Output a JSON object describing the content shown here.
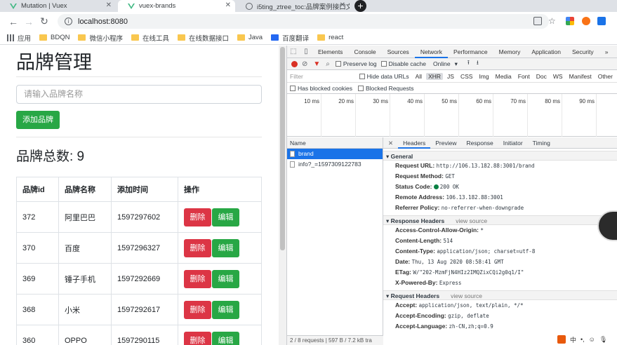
{
  "browser": {
    "tabs": [
      {
        "title": "Mutation | Vuex"
      },
      {
        "title": "vuex-brands"
      },
      {
        "title": "i5ting_ztree_toc:品牌案例接口文"
      }
    ],
    "url": "localhost:8080",
    "bookmarks": [
      "应用",
      "BDQN",
      "微信小程序",
      "在线工具",
      "在线数据接口",
      "Java",
      "百度翻译",
      "react"
    ]
  },
  "app": {
    "title": "品牌管理",
    "search_placeholder": "请输入品牌名称",
    "add_button": "添加品牌",
    "count_label": "品牌总数: 9",
    "columns": [
      "品牌id",
      "品牌名称",
      "添加时间",
      "操作"
    ],
    "delete_label": "删除",
    "edit_label": "编辑",
    "rows": [
      {
        "id": "372",
        "name": "阿里巴巴",
        "time": "1597297602"
      },
      {
        "id": "370",
        "name": "百度",
        "time": "1597296327"
      },
      {
        "id": "369",
        "name": "锤子手机",
        "time": "1597292669"
      },
      {
        "id": "368",
        "name": "小米",
        "time": "1597292617"
      },
      {
        "id": "360",
        "name": "OPPO",
        "time": "1597290115"
      }
    ]
  },
  "devtools": {
    "tabs": [
      "Elements",
      "Console",
      "Sources",
      "Network",
      "Performance",
      "Memory",
      "Application",
      "Security"
    ],
    "more": "»",
    "toolbar": {
      "preserve_log": "Preserve log",
      "disable_cache": "Disable cache",
      "throttle": "Online"
    },
    "filter_placeholder": "Filter",
    "hide_data_urls": "Hide data URLs",
    "types": [
      "All",
      "XHR",
      "JS",
      "CSS",
      "Img",
      "Media",
      "Font",
      "Doc",
      "WS",
      "Manifest",
      "Other"
    ],
    "has_blocked_cookies": "Has blocked cookies",
    "blocked_requests": "Blocked Requests",
    "ticks": [
      "10 ms",
      "20 ms",
      "30 ms",
      "40 ms",
      "50 ms",
      "60 ms",
      "70 ms",
      "80 ms",
      "90 ms"
    ],
    "name_header": "Name",
    "requests": [
      "brand",
      "info?_=1597309122783"
    ],
    "status_bar": "2 / 8 requests | 597 B / 7.2 kB tra",
    "detail_tabs": [
      "Headers",
      "Preview",
      "Response",
      "Initiator",
      "Timing"
    ],
    "general": {
      "title": "General",
      "rows": [
        {
          "k": "Request URL:",
          "v": "http://106.13.182.88:3001/brand"
        },
        {
          "k": "Request Method:",
          "v": "GET"
        },
        {
          "k": "Status Code:",
          "v": "200 OK"
        },
        {
          "k": "Remote Address:",
          "v": "106.13.182.88:3001"
        },
        {
          "k": "Referrer Policy:",
          "v": "no-referrer-when-downgrade"
        }
      ]
    },
    "response_headers": {
      "title": "Response Headers",
      "view_source": "view source",
      "rows": [
        {
          "k": "Access-Control-Allow-Origin:",
          "v": "*"
        },
        {
          "k": "Content-Length:",
          "v": "514"
        },
        {
          "k": "Content-Type:",
          "v": "application/json; charset=utf-8"
        },
        {
          "k": "Date:",
          "v": "Thu, 13 Aug 2020 08:58:41 GMT"
        },
        {
          "k": "ETag:",
          "v": "W/\"202-MzmFjN4HIz2IMQZixCQi2g0q1/I\""
        },
        {
          "k": "X-Powered-By:",
          "v": "Express"
        }
      ]
    },
    "request_headers": {
      "title": "Request Headers",
      "view_source": "view source",
      "rows": [
        {
          "k": "Accept:",
          "v": "application/json, text/plain, */*"
        },
        {
          "k": "Accept-Encoding:",
          "v": "gzip, deflate"
        },
        {
          "k": "Accept-Language:",
          "v": "zh-CN,zh;q=0.9"
        }
      ]
    }
  },
  "ime": {
    "label": "中"
  }
}
